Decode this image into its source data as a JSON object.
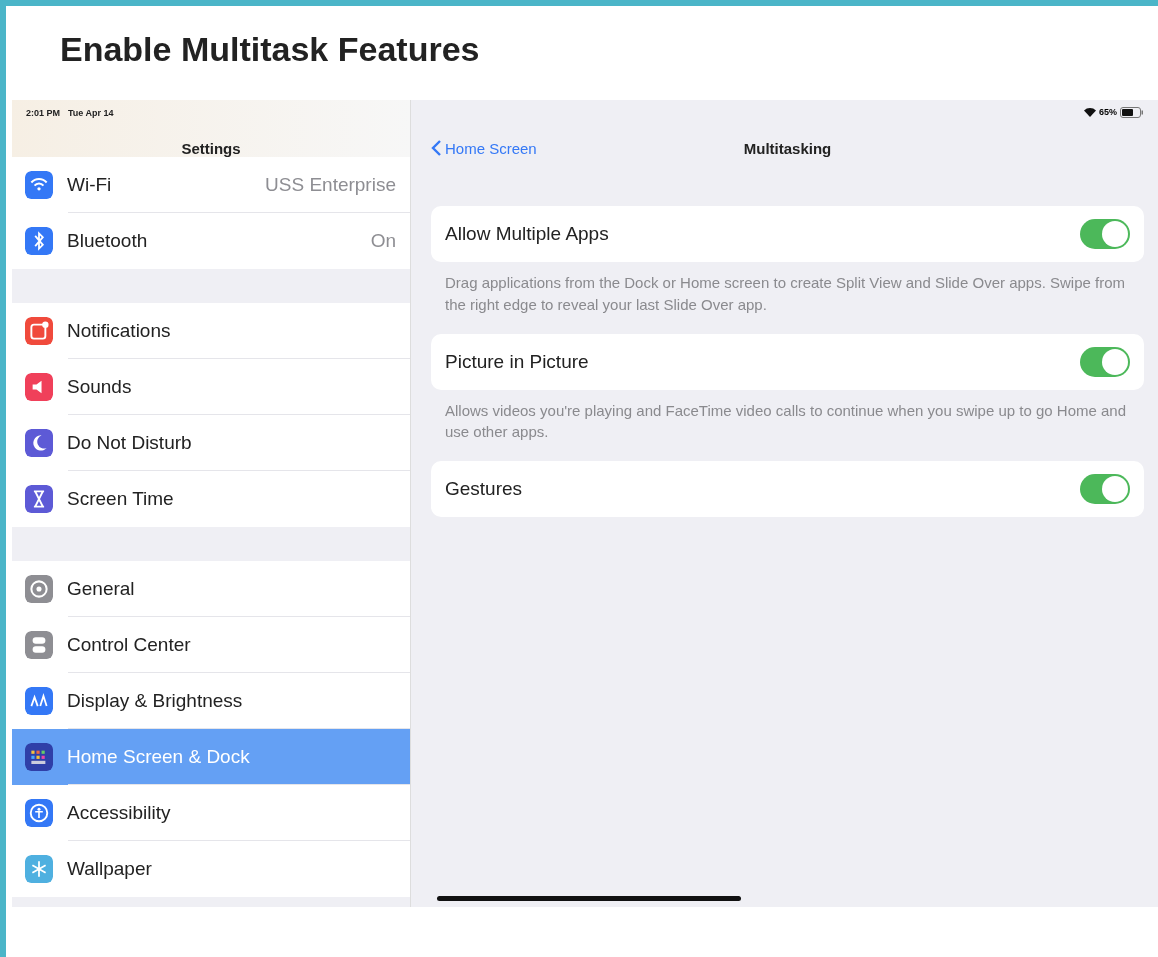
{
  "heading": "Enable Multitask Features",
  "status_bar": {
    "time": "2:01 PM",
    "date": "Tue Apr 14",
    "battery": "65%"
  },
  "sidebar": {
    "title": "Settings",
    "groups": [
      [
        {
          "label": "Wi-Fi",
          "value": "USS Enterprise",
          "color": "#3478f6",
          "selected": false
        },
        {
          "label": "Bluetooth",
          "value": "On",
          "color": "#3478f6",
          "selected": false
        }
      ],
      [
        {
          "label": "Notifications",
          "color": "#f04a3c",
          "selected": false
        },
        {
          "label": "Sounds",
          "color": "#f0405a",
          "selected": false
        },
        {
          "label": "Do Not Disturb",
          "color": "#5d5ad6",
          "selected": false
        },
        {
          "label": "Screen Time",
          "color": "#5d5ad6",
          "selected": false
        }
      ],
      [
        {
          "label": "General",
          "color": "#8e8e93",
          "selected": false
        },
        {
          "label": "Control Center",
          "color": "#8e8e93",
          "selected": false
        },
        {
          "label": "Display & Brightness",
          "color": "#3478f6",
          "selected": false
        },
        {
          "label": "Home Screen & Dock",
          "color": "#2f3fa8",
          "selected": true
        },
        {
          "label": "Accessibility",
          "color": "#3478f6",
          "selected": false
        },
        {
          "label": "Wallpaper",
          "color": "#4fb0e0",
          "selected": false
        }
      ]
    ]
  },
  "detail": {
    "back": "Home Screen",
    "title": "Multitasking",
    "settings": [
      {
        "label": "Allow Multiple Apps",
        "on": true,
        "footer": "Drag applications from the Dock or Home screen to create Split View and Slide Over apps. Swipe from the right edge to reveal your last Slide Over app."
      },
      {
        "label": "Picture in Picture",
        "on": true,
        "footer": "Allows videos you're playing and FaceTime video calls to continue when you swipe up to go Home and use other apps."
      },
      {
        "label": "Gestures",
        "on": true
      }
    ]
  }
}
